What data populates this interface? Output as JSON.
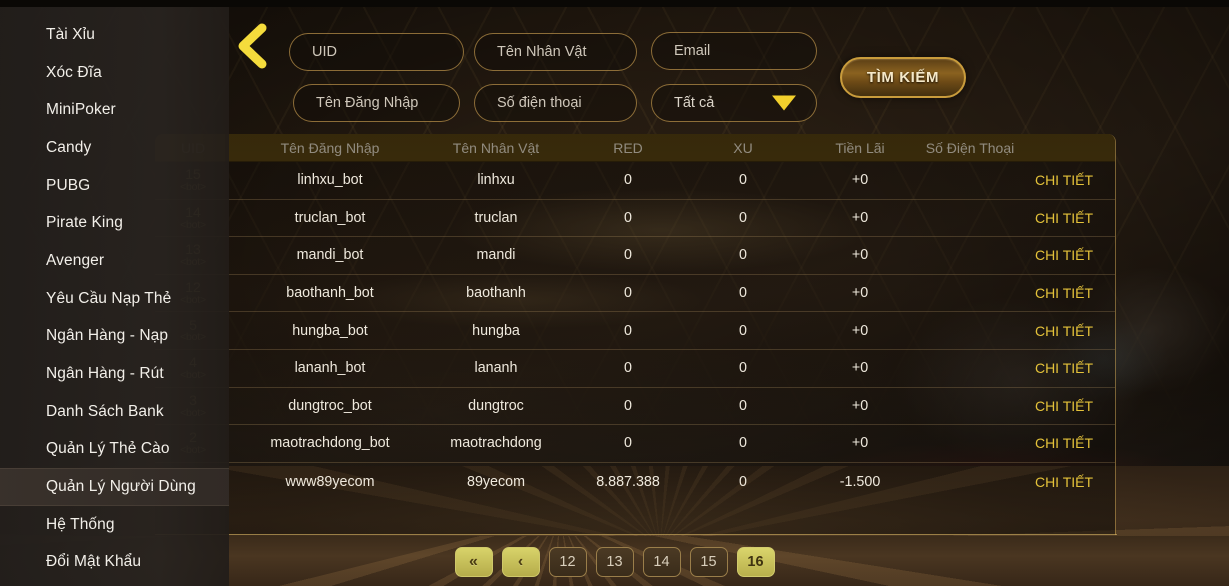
{
  "sidebar": {
    "items": [
      {
        "label": "Tài Xỉu",
        "active": false
      },
      {
        "label": "Xóc Đĩa",
        "active": false
      },
      {
        "label": "MiniPoker",
        "active": false
      },
      {
        "label": "Candy",
        "active": false
      },
      {
        "label": "PUBG",
        "active": false
      },
      {
        "label": "Pirate King",
        "active": false
      },
      {
        "label": "Avenger",
        "active": false
      },
      {
        "label": "Yêu Cầu Nạp Thẻ",
        "active": false
      },
      {
        "label": "Ngân Hàng - Nạp",
        "active": false
      },
      {
        "label": "Ngân Hàng - Rút",
        "active": false
      },
      {
        "label": "Danh Sách Bank",
        "active": false
      },
      {
        "label": "Quản Lý Thẻ Cào",
        "active": false
      },
      {
        "label": "Quản Lý Người Dùng",
        "active": true
      },
      {
        "label": "Hệ Thống",
        "active": false
      },
      {
        "label": "Đổi Mật Khẩu",
        "active": false
      }
    ]
  },
  "toolbar": {
    "back_icon": "chevron-left-icon",
    "search_button_label": "TÌM KIẾM",
    "fields": {
      "uid_placeholder": "UID",
      "character_name_placeholder": "Tên Nhân Vật",
      "email_placeholder": "Email",
      "login_name_placeholder": "Tên Đăng Nhập",
      "phone_placeholder": "Số điện thoại",
      "type_select_value": "Tất cả",
      "type_select_icon": "chevron-down-icon"
    }
  },
  "table": {
    "columns": [
      {
        "key": "uid",
        "label": "UID"
      },
      {
        "key": "login",
        "label": "Tên Đăng Nhập"
      },
      {
        "key": "char",
        "label": "Tên Nhân Vật"
      },
      {
        "key": "red",
        "label": "RED"
      },
      {
        "key": "xu",
        "label": "XU"
      },
      {
        "key": "profit",
        "label": "Tiền Lãi"
      },
      {
        "key": "phone",
        "label": "Số Điện Thoại"
      }
    ],
    "detail_label": "CHI TIẾT",
    "bot_tag": "<bot>",
    "rows": [
      {
        "uid": "15",
        "bot": true,
        "login": "linhxu_bot",
        "char": "linhxu",
        "red": "0",
        "xu": "0",
        "profit": "+0",
        "phone": "",
        "detail": "CHI TIẾT"
      },
      {
        "uid": "14",
        "bot": true,
        "login": "truclan_bot",
        "char": "truclan",
        "red": "0",
        "xu": "0",
        "profit": "+0",
        "phone": "",
        "detail": "CHI TIẾT"
      },
      {
        "uid": "13",
        "bot": true,
        "login": "mandi_bot",
        "char": "mandi",
        "red": "0",
        "xu": "0",
        "profit": "+0",
        "phone": "",
        "detail": "CHI TIẾT"
      },
      {
        "uid": "12",
        "bot": true,
        "login": "baothanh_bot",
        "char": "baothanh",
        "red": "0",
        "xu": "0",
        "profit": "+0",
        "phone": "",
        "detail": "CHI TIẾT"
      },
      {
        "uid": "5",
        "bot": true,
        "login": "hungba_bot",
        "char": "hungba",
        "red": "0",
        "xu": "0",
        "profit": "+0",
        "phone": "",
        "detail": "CHI TIẾT"
      },
      {
        "uid": "4",
        "bot": true,
        "login": "lananh_bot",
        "char": "lananh",
        "red": "0",
        "xu": "0",
        "profit": "+0",
        "phone": "",
        "detail": "CHI TIẾT"
      },
      {
        "uid": "3",
        "bot": true,
        "login": "dungtroc_bot",
        "char": "dungtroc",
        "red": "0",
        "xu": "0",
        "profit": "+0",
        "phone": "",
        "detail": "CHI TIẾT"
      },
      {
        "uid": "2",
        "bot": true,
        "login": "maotrachdong_bot",
        "char": "maotrachdong",
        "red": "0",
        "xu": "0",
        "profit": "+0",
        "phone": "",
        "detail": "CHI TIẾT"
      },
      {
        "uid": "",
        "bot": false,
        "login": "www89yecom",
        "char": "89yecom",
        "red": "8.887.388",
        "xu": "0",
        "profit": "-1.500",
        "phone": "",
        "detail": "CHI TIẾT"
      }
    ]
  },
  "pagination": {
    "first_label": "«",
    "prev_label": "‹",
    "pages": [
      "12",
      "13",
      "14",
      "15",
      "16"
    ],
    "active_page": "16"
  },
  "colors": {
    "accent_gold": "#e4c23a",
    "header_bar": "#55400e",
    "field_border": "#ba924a",
    "pager_active": "#dad56c"
  }
}
